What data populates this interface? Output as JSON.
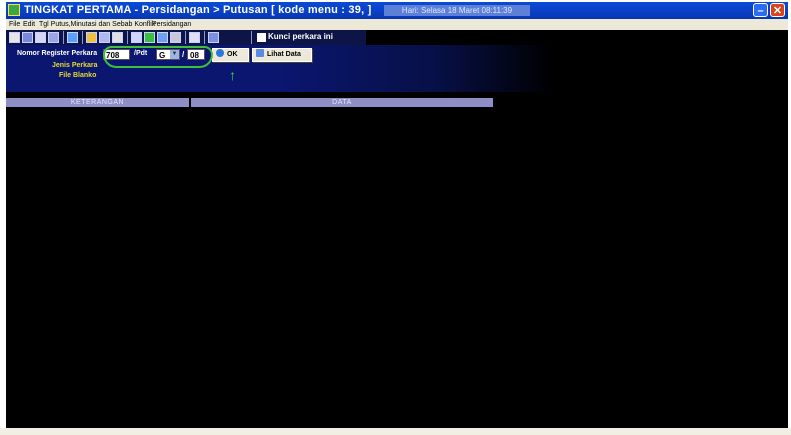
{
  "window": {
    "title": "TINGKAT PERTAMA - Persidangan > Putusan  [ kode menu : 39, ]",
    "status": "Hari: Selasa 18 Maret 08:11:39",
    "controls": {
      "minimize": "–",
      "close": "✕"
    }
  },
  "menu": [
    "File",
    "Edit",
    "Tgl Putus,Minutasi dan Sebab Konflik",
    "Persidangan"
  ],
  "toolbar": {
    "icons": [
      "new-icon",
      "save-icon",
      "print-icon",
      "export-icon",
      "refresh-icon",
      "copy-icon",
      "cut-icon",
      "paste-icon",
      "list-icon",
      "green-icon",
      "window-icon",
      "arrow-icon",
      "calendar-icon",
      "monitor-icon"
    ],
    "kunci_label": "Kunci perkara ini"
  },
  "form": {
    "nomor_label": "Nomor Register Perkara",
    "nomor_value": "708",
    "pdt_label": "/Pdt",
    "pdt_value": "G",
    "pdt_arrow": "▼",
    "slash": "/",
    "year_value": "08",
    "ok_label": "OK",
    "lihat_label": "Lihat Data",
    "jenis_label": "Jenis Perkara",
    "file_label": "File Blanko",
    "annotation_arrow": "↑"
  },
  "grid": {
    "headers": [
      "KETERANGAN",
      "DATA"
    ]
  },
  "colors": {
    "title_bar": "#0a4bd6",
    "label_yellow": "#e8dc2c",
    "annotation_green": "#3fbf3a",
    "header_bg": "#8f8fc8"
  }
}
